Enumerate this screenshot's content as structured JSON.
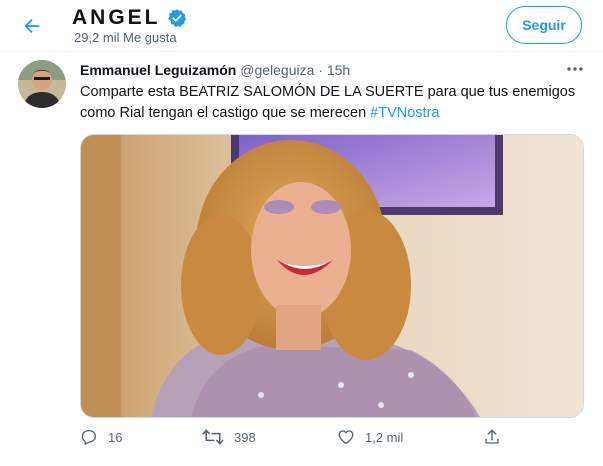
{
  "header": {
    "title": "ANGEL",
    "subtitle": "29,2 mil Me gusta",
    "follow_label": "Seguir"
  },
  "tweet": {
    "author_name": "Emmanuel Leguizamón",
    "handle": "@geleguiza",
    "separator": "·",
    "time": "15h",
    "text": "Comparte esta BEATRIZ SALOMÓN DE LA SUERTE para que tus enemigos como Rial tengan el castigo que se merecen ",
    "hashtag": "#TVNostra"
  },
  "actions": {
    "reply_count": "16",
    "retweet_count": "398",
    "like_count": "1,2 mil"
  },
  "colors": {
    "accent": "#1d9bf0",
    "muted_text": "#536471",
    "border": "#eff3f4"
  },
  "icons": [
    "back-arrow-icon",
    "verified-badge-icon",
    "more-icon",
    "reply-icon",
    "retweet-icon",
    "like-icon",
    "share-icon"
  ]
}
